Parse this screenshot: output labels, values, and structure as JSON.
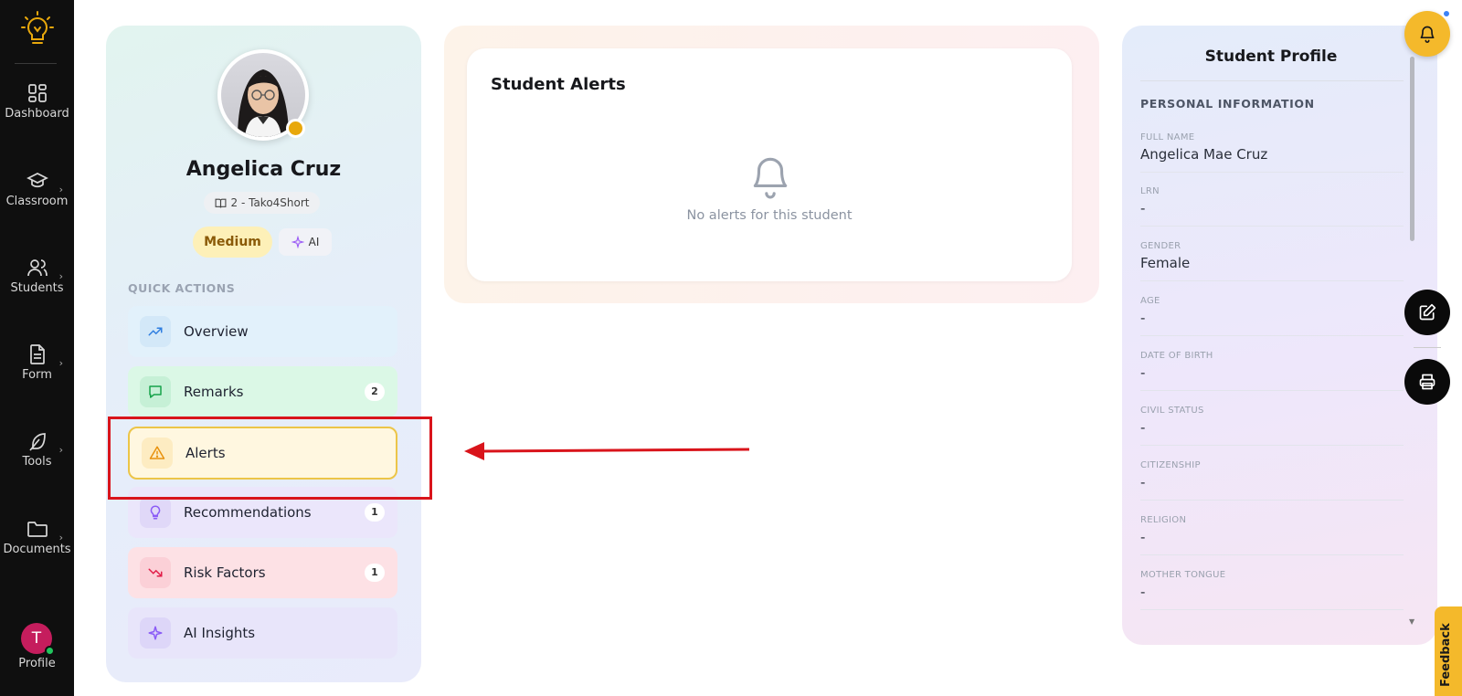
{
  "nav": {
    "items": [
      {
        "label": "Dashboard",
        "icon": "dashboard-grid-icon"
      },
      {
        "label": "Classroom",
        "icon": "graduation-cap-icon"
      },
      {
        "label": "Students",
        "icon": "users-icon"
      },
      {
        "label": "Form",
        "icon": "document-icon"
      },
      {
        "label": "Tools",
        "icon": "feather-icon"
      },
      {
        "label": "Documents",
        "icon": "folder-icon"
      }
    ],
    "profile_initial": "T",
    "profile_label": "Profile",
    "avatar_color": "#c51d5d"
  },
  "student": {
    "name": "Angelica Cruz",
    "section": "2 - Tako4Short",
    "risk_level": "Medium",
    "ai_label": "AI"
  },
  "quick_actions": {
    "title": "QUICK ACTIONS",
    "items": [
      {
        "label": "Overview",
        "count": null,
        "icon": "trending-up-icon"
      },
      {
        "label": "Remarks",
        "count": "2",
        "icon": "message-icon"
      },
      {
        "label": "Alerts",
        "count": null,
        "icon": "warning-triangle-icon",
        "active": true
      },
      {
        "label": "Recommendations",
        "count": "1",
        "icon": "lightbulb-icon"
      },
      {
        "label": "Risk Factors",
        "count": "1",
        "icon": "trending-down-icon"
      },
      {
        "label": "AI Insights",
        "count": null,
        "icon": "sparkles-icon"
      }
    ]
  },
  "alerts_panel": {
    "title": "Student Alerts",
    "empty_message": "No alerts for this student"
  },
  "profile_panel": {
    "title": "Student Profile",
    "section_title": "PERSONAL INFORMATION",
    "fields": [
      {
        "label": "FULL NAME",
        "value": "Angelica Mae Cruz"
      },
      {
        "label": "LRN",
        "value": "-"
      },
      {
        "label": "GENDER",
        "value": "Female"
      },
      {
        "label": "AGE",
        "value": "-"
      },
      {
        "label": "DATE OF BIRTH",
        "value": "-"
      },
      {
        "label": "CIVIL STATUS",
        "value": "-"
      },
      {
        "label": "CITIZENSHIP",
        "value": "-"
      },
      {
        "label": "RELIGION",
        "value": "-"
      },
      {
        "label": "MOTHER TONGUE",
        "value": "-"
      }
    ]
  },
  "feedback_label": "Feedback",
  "colors": {
    "accent_yellow": "#f4b92b",
    "annotation_red": "#d9141b",
    "nav_bg": "#0f0f0f"
  }
}
